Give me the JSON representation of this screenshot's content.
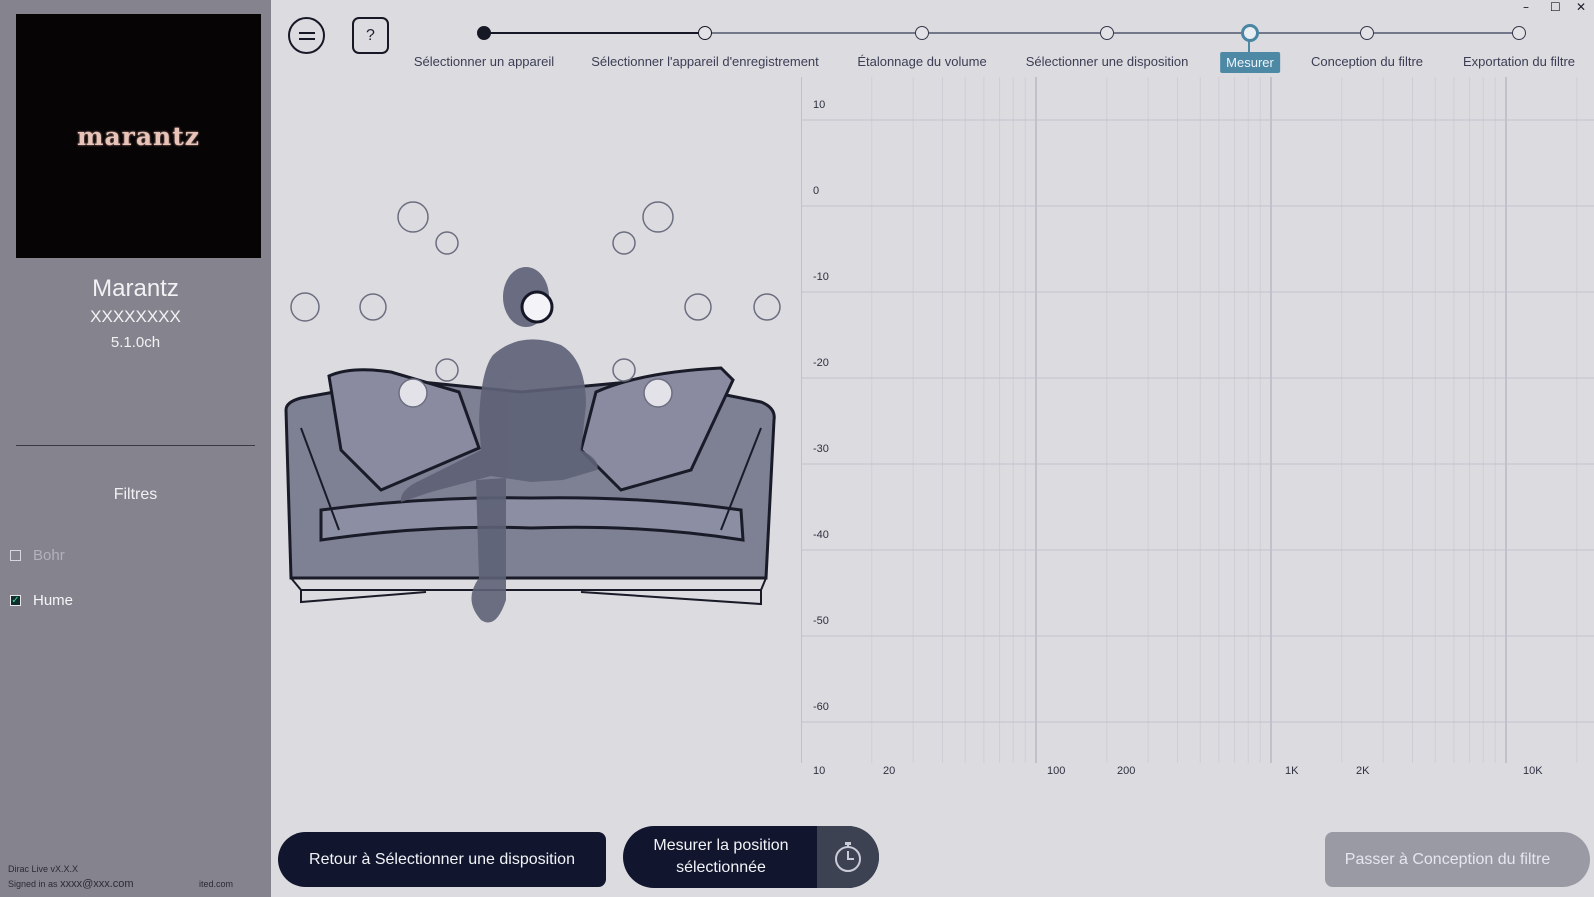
{
  "window": {
    "minimize": "–",
    "maximize": "☐",
    "close": "✕"
  },
  "sidebar": {
    "logo": "marantz",
    "device_name": "Marantz",
    "device_serial": "XXXXXXXX",
    "device_channels": "5.1.0ch",
    "filters_title": "Filtres",
    "filters": [
      {
        "label": "Bohr",
        "checked": false
      },
      {
        "label": "Hume",
        "checked": true
      }
    ],
    "version": "Dirac Live vX.X.X",
    "signed_in_prefix": "Signed in as",
    "signed_in_email": "xxxx@xxx.com",
    "footer_url": "ited.com"
  },
  "toolbar": {
    "help_label": "?"
  },
  "steps": [
    {
      "label": "Sélectionner un appareil",
      "state": "done"
    },
    {
      "label": "Sélectionner l'appareil d'enregistrement",
      "state": "current"
    },
    {
      "label": "Étalonnage du volume",
      "state": "todo"
    },
    {
      "label": "Sélectionner une disposition",
      "state": "todo"
    },
    {
      "label": "Mesurer",
      "state": "active"
    },
    {
      "label": "Conception du filtre",
      "state": "todo"
    },
    {
      "label": "Exportation du filtre",
      "state": "todo"
    }
  ],
  "graph": {
    "y_ticks": [
      "10",
      "0",
      "-10",
      "-20",
      "-30",
      "-40",
      "-50",
      "-60"
    ],
    "x_ticks": [
      "10",
      "20",
      "100",
      "200",
      "1K",
      "2K",
      "10K"
    ]
  },
  "buttons": {
    "back": "Retour à Sélectionner une disposition",
    "measure_line1": "Mesurer la position",
    "measure_line2": "sélectionnée",
    "next": "Passer à Conception du filtre"
  },
  "colors": {
    "accent": "#4d88a5",
    "dark_button": "#11162e",
    "sidebar": "#85838d"
  }
}
